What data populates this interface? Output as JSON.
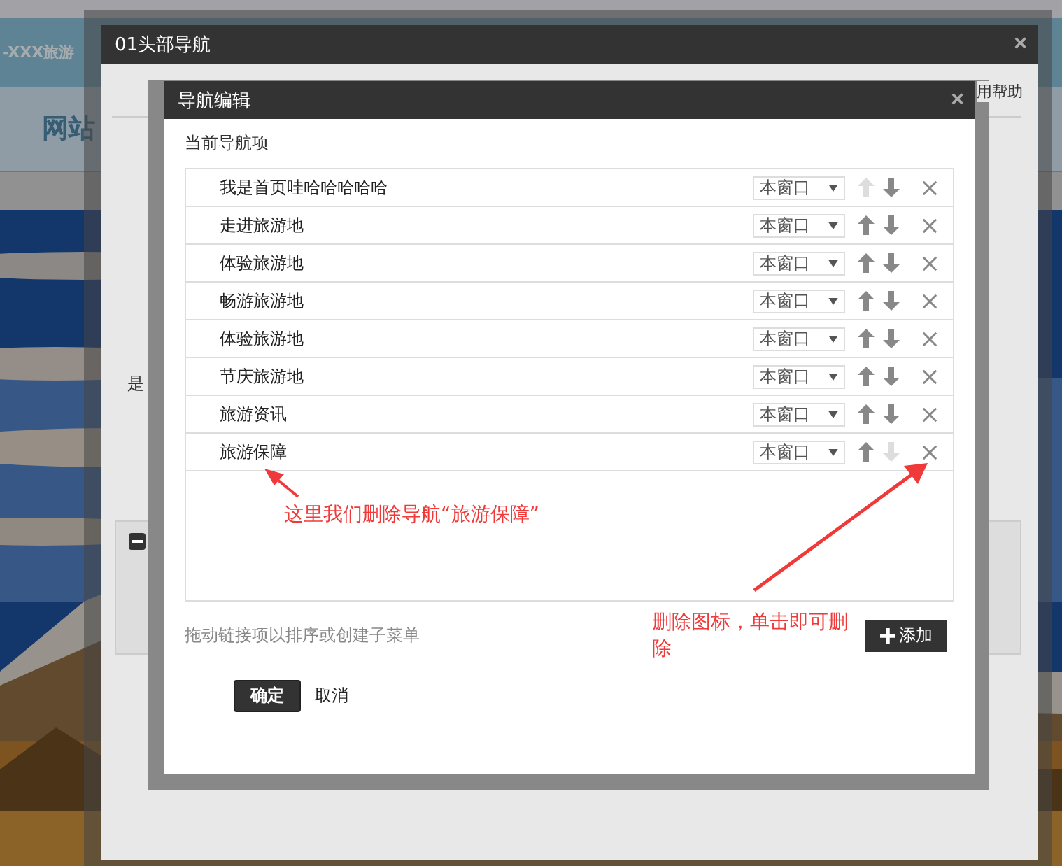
{
  "background_page": {
    "site_title": "-XXX旅游",
    "nav_items": [
      "网站"
    ],
    "banner": {
      "kind": "picture"
    }
  },
  "outer_dialog": {
    "title": "01头部导航",
    "close": "×",
    "help_link": "用帮助",
    "field_label": "是"
  },
  "nav_editor": {
    "title": "导航编辑",
    "close": "×",
    "section_label": "当前导航项",
    "items": [
      {
        "label": "我是首页哇哈哈哈哈哈",
        "target": "本窗口",
        "up_enabled": false,
        "down_enabled": true
      },
      {
        "label": "走进旅游地",
        "target": "本窗口",
        "up_enabled": true,
        "down_enabled": true
      },
      {
        "label": "体验旅游地",
        "target": "本窗口",
        "up_enabled": true,
        "down_enabled": true
      },
      {
        "label": "畅游旅游地",
        "target": "本窗口",
        "up_enabled": true,
        "down_enabled": true
      },
      {
        "label": "体验旅游地",
        "target": "本窗口",
        "up_enabled": true,
        "down_enabled": true
      },
      {
        "label": "节庆旅游地",
        "target": "本窗口",
        "up_enabled": true,
        "down_enabled": true
      },
      {
        "label": "旅游资讯",
        "target": "本窗口",
        "up_enabled": true,
        "down_enabled": true
      },
      {
        "label": "旅游保障",
        "target": "本窗口",
        "up_enabled": true,
        "down_enabled": false
      }
    ],
    "hint": "拖动链接项以排序或创建子菜单",
    "add_button": "添加",
    "confirm_button": "确定",
    "cancel_button": "取消"
  },
  "annotations": [
    {
      "kind": "item",
      "text": "这里我们删除导航“旅游保障”"
    },
    {
      "kind": "delete",
      "text": "删除图标，单击即可删除"
    }
  ]
}
